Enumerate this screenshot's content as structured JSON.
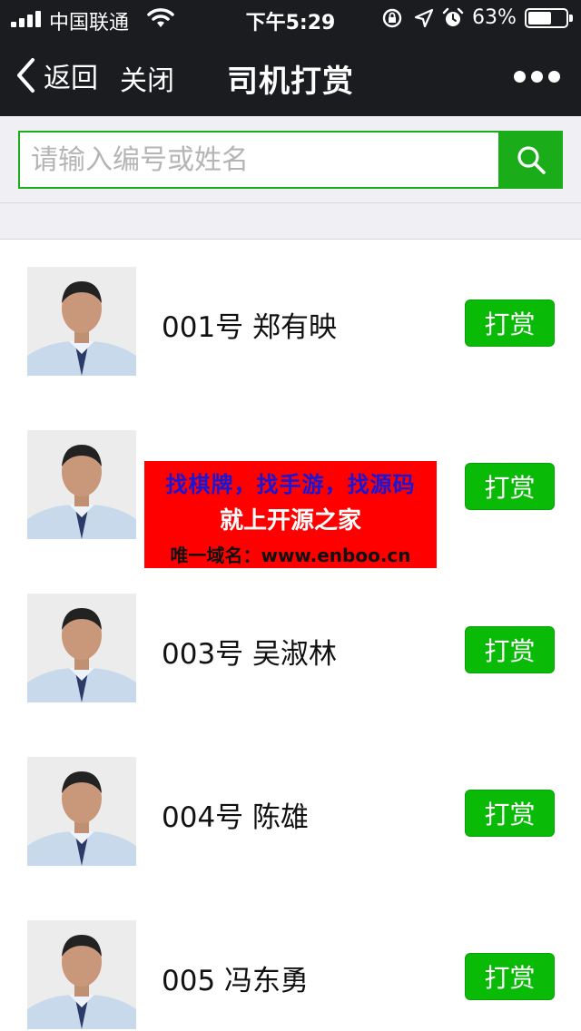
{
  "status_bar": {
    "carrier": "中国联通",
    "time": "下午5:29",
    "battery_percent_label": "63%",
    "battery_level": 0.63
  },
  "nav": {
    "back_label": "返回",
    "close_label": "关闭",
    "title": "司机打赏"
  },
  "search": {
    "placeholder": "请输入编号或姓名",
    "value": ""
  },
  "drivers": [
    {
      "name": "001号 郑有映",
      "button": "打赏"
    },
    {
      "name": "",
      "button": "打赏"
    },
    {
      "name": "003号 吴淑林",
      "button": "打赏"
    },
    {
      "name": "004号 陈雄",
      "button": "打赏"
    },
    {
      "name": "005 冯东勇",
      "button": "打赏"
    }
  ],
  "ad": {
    "line1": "找棋牌，找手游，找源码",
    "line2": "就上开源之家",
    "line3": "唯一域名：www.enboo.cn"
  },
  "colors": {
    "nav_bg": "#1b1c20",
    "accent_green": "#09bb07",
    "page_bg": "#efeff4",
    "ad_bg": "#ff0000",
    "ad_line1": "#1717d8"
  }
}
